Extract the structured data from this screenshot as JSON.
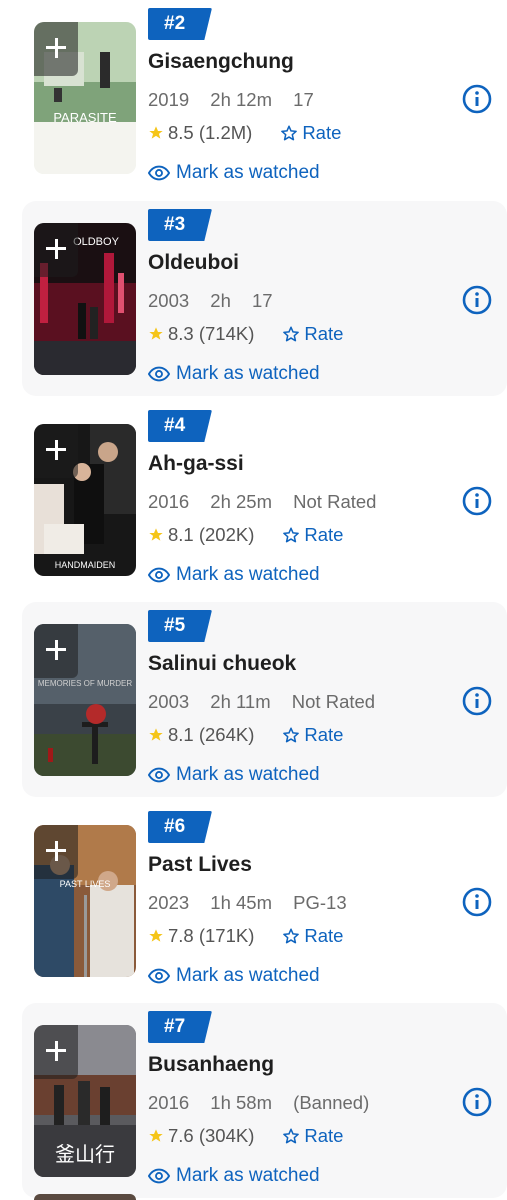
{
  "colors": {
    "accent": "#0e63be",
    "star": "#f5c518"
  },
  "movies": [
    {
      "rank": "#2",
      "title": "Gisaengchung",
      "year": "2019",
      "runtime": "2h 12m",
      "cert": "17",
      "rating": "8.5 (1.2M)",
      "rate_label": "Rate",
      "watched_label": "Mark as watched",
      "poster_text": "PARASITE"
    },
    {
      "rank": "#3",
      "title": "Oldeuboi",
      "year": "2003",
      "runtime": "2h",
      "cert": "17",
      "rating": "8.3 (714K)",
      "rate_label": "Rate",
      "watched_label": "Mark as watched",
      "poster_text": "OLDBOY"
    },
    {
      "rank": "#4",
      "title": "Ah-ga-ssi",
      "year": "2016",
      "runtime": "2h 25m",
      "cert": "Not Rated",
      "rating": "8.1 (202K)",
      "rate_label": "Rate",
      "watched_label": "Mark as watched",
      "poster_text": "HANDMAIDEN"
    },
    {
      "rank": "#5",
      "title": "Salinui chueok",
      "year": "2003",
      "runtime": "2h 11m",
      "cert": "Not Rated",
      "rating": "8.1 (264K)",
      "rate_label": "Rate",
      "watched_label": "Mark as watched",
      "poster_text": "MEMORIES OF MURDER"
    },
    {
      "rank": "#6",
      "title": "Past Lives",
      "year": "2023",
      "runtime": "1h 45m",
      "cert": "PG-13",
      "rating": "7.8 (171K)",
      "rate_label": "Rate",
      "watched_label": "Mark as watched",
      "poster_text": "PAST LIVES"
    },
    {
      "rank": "#7",
      "title": "Busanhaeng",
      "year": "2016",
      "runtime": "1h 58m",
      "cert": "(Banned)",
      "rating": "7.6 (304K)",
      "rate_label": "Rate",
      "watched_label": "Mark as watched",
      "poster_text": "釜山行"
    }
  ]
}
